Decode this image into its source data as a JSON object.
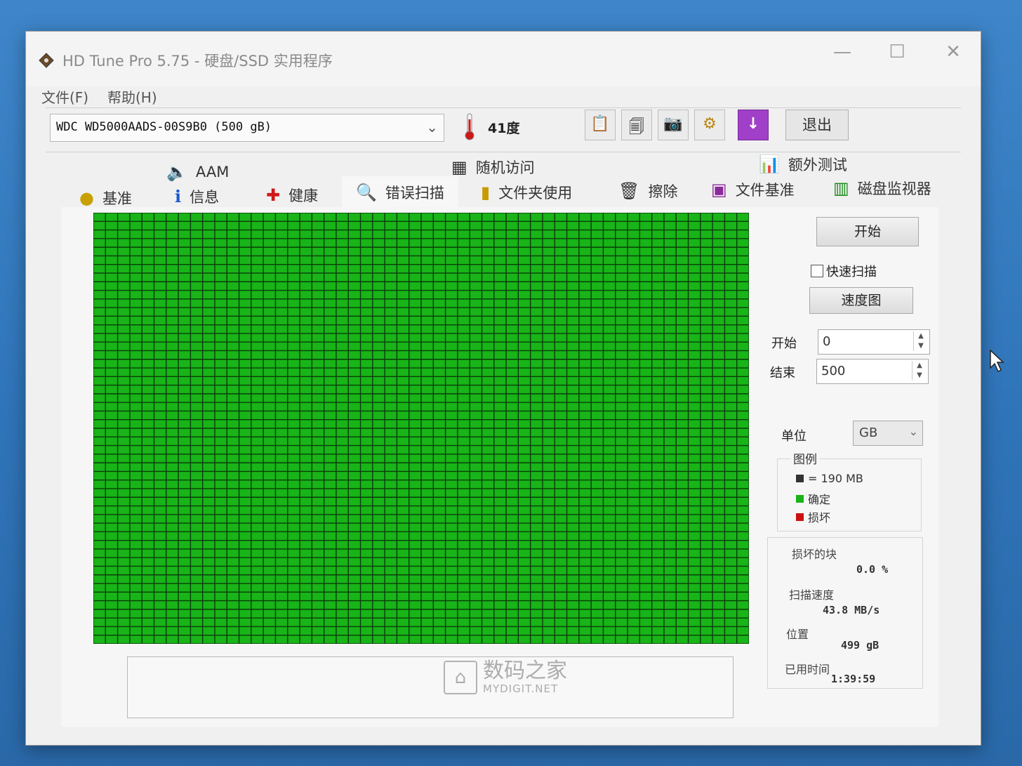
{
  "window": {
    "title": "HD Tune Pro 5.75 - 硬盘/SSD 实用程序",
    "controls": {
      "minimize": "—",
      "maximize": "☐",
      "close": "✕"
    }
  },
  "menu": {
    "file": "文件(F)",
    "help": "帮助(H)"
  },
  "toolbar": {
    "drive": "WDC WD5000AADS-00S9B0 (500 gB)",
    "temperature": "41度",
    "exit_label": "退出",
    "icons": [
      "copy-text-icon",
      "copy-screenshot-icon",
      "camera-icon",
      "options-icon",
      "download-icon"
    ]
  },
  "tabs": {
    "aam": "AAM",
    "random_access": "随机访问",
    "extra_tests": "额外测试",
    "benchmark": "基准",
    "info": "信息",
    "health": "健康",
    "error_scan": "错误扫描",
    "folder_usage": "文件夹使用",
    "erase": "擦除",
    "file_benchmark": "文件基准",
    "disk_monitor": "磁盘监视器"
  },
  "scan_grid": {
    "columns": 54,
    "rows": 50,
    "block_status": "ok",
    "colors": {
      "ok": "#18b418",
      "grid_line": "#0b3d0b",
      "damaged": "#cc1010"
    }
  },
  "side_panel": {
    "start_button": "开始",
    "quick_scan_label": "快速扫描",
    "quick_scan_checked": false,
    "speed_map_button": "速度图",
    "start_label": "开始",
    "start_value": "0",
    "end_label": "结束",
    "end_value": "500",
    "unit_label": "单位",
    "unit_value": "GB",
    "legend_title": "图例",
    "legend_block": "= 190 MB",
    "legend_ok": "确定",
    "legend_damaged": "损坏",
    "damaged_blocks_label": "损坏的块",
    "damaged_blocks_value": "0.0 %",
    "scan_speed_label": "扫描速度",
    "scan_speed_value": "43.8 MB/s",
    "position_label": "位置",
    "position_value": "499 gB",
    "elapsed_label": "已用时间",
    "elapsed_value": "1:39:59"
  },
  "watermark": {
    "main": "数码之家",
    "sub": "MYDIGIT.NET"
  }
}
